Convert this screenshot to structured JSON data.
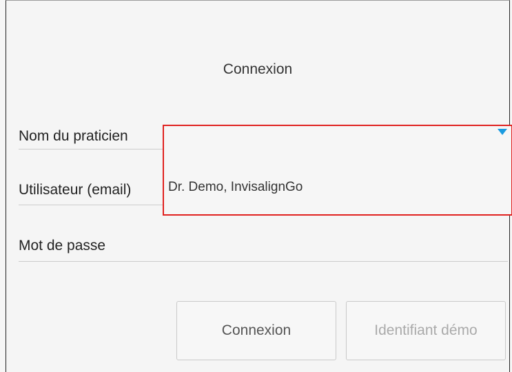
{
  "login": {
    "title": "Connexion",
    "practitioner_label": "Nom du praticien",
    "user_label": "Utilisateur (email)",
    "password_label": "Mot de passe",
    "dropdown_option": "Dr. Demo, InvisalignGo",
    "login_button": "Connexion",
    "demo_button": "Identifiant démo"
  },
  "colors": {
    "highlight_border": "#e0201e",
    "dropdown_arrow": "#1a9be0"
  }
}
